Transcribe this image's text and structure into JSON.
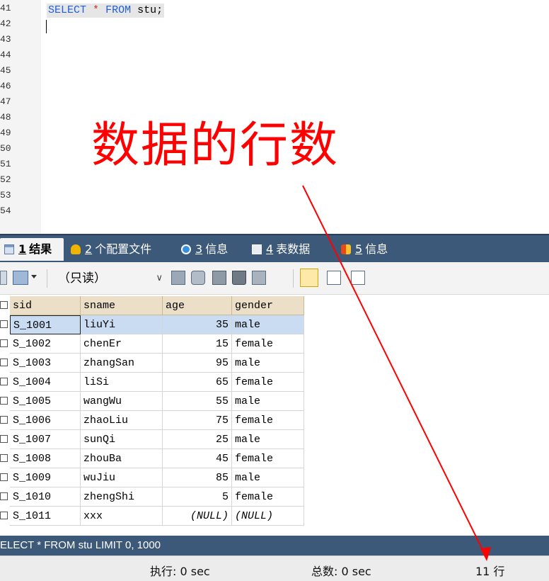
{
  "editor": {
    "line_numbers": [
      "41",
      "42",
      "43",
      "44",
      "45",
      "46",
      "47",
      "48",
      "49",
      "50",
      "51",
      "52",
      "53",
      "54"
    ],
    "code_tokens": {
      "select_kw": "SELECT",
      "star": "*",
      "from_kw": "FROM",
      "table": "stu;"
    },
    "annotation": "数据的行数"
  },
  "tabs": [
    {
      "num": "1",
      "label": "结果",
      "icon": "grid-result-icon",
      "active": true
    },
    {
      "num": "2",
      "label": "个配置文件",
      "icon": "profile-icon",
      "active": false
    },
    {
      "num": "3",
      "label": "信息",
      "icon": "info-icon",
      "active": false
    },
    {
      "num": "4",
      "label": "表数据",
      "icon": "table-data-icon",
      "active": false
    },
    {
      "num": "5",
      "label": "信息",
      "icon": "info-color-icon",
      "active": false
    }
  ],
  "toolbar": {
    "mode_value": "（只读）",
    "icons": [
      "grid-view-icon",
      "export-icon",
      "insert-row-icon",
      "duplicate-row-icon",
      "save-icon",
      "delete-icon",
      "cancel-icon",
      "grid-mode-icon",
      "form-mode-icon",
      "text-mode-icon"
    ]
  },
  "grid": {
    "columns": [
      "sid",
      "sname",
      "age",
      "gender"
    ],
    "rows": [
      [
        "S_1001",
        "liuYi",
        "35",
        "male"
      ],
      [
        "S_1002",
        "chenEr",
        "15",
        "female"
      ],
      [
        "S_1003",
        "zhangSan",
        "95",
        "male"
      ],
      [
        "S_1004",
        "liSi",
        "65",
        "female"
      ],
      [
        "S_1005",
        "wangWu",
        "55",
        "male"
      ],
      [
        "S_1006",
        "zhaoLiu",
        "75",
        "female"
      ],
      [
        "S_1007",
        "sunQi",
        "25",
        "male"
      ],
      [
        "S_1008",
        "zhouBa",
        "45",
        "female"
      ],
      [
        "S_1009",
        "wuJiu",
        "85",
        "male"
      ],
      [
        "S_1010",
        "zhengShi",
        "5",
        "female"
      ],
      [
        "S_1011",
        "xxx",
        "(NULL)",
        "(NULL)"
      ]
    ]
  },
  "status": {
    "sql": "ELECT * FROM stu LIMIT 0, 1000",
    "exec": "执行: 0 sec",
    "total": "总数: 0 sec",
    "rows": "11 行"
  },
  "colors": {
    "annotation": "#ff0000",
    "tabbar": "#3d5979",
    "header_cell": "#ecdfc8",
    "selected_row": "#c9dcf2"
  }
}
